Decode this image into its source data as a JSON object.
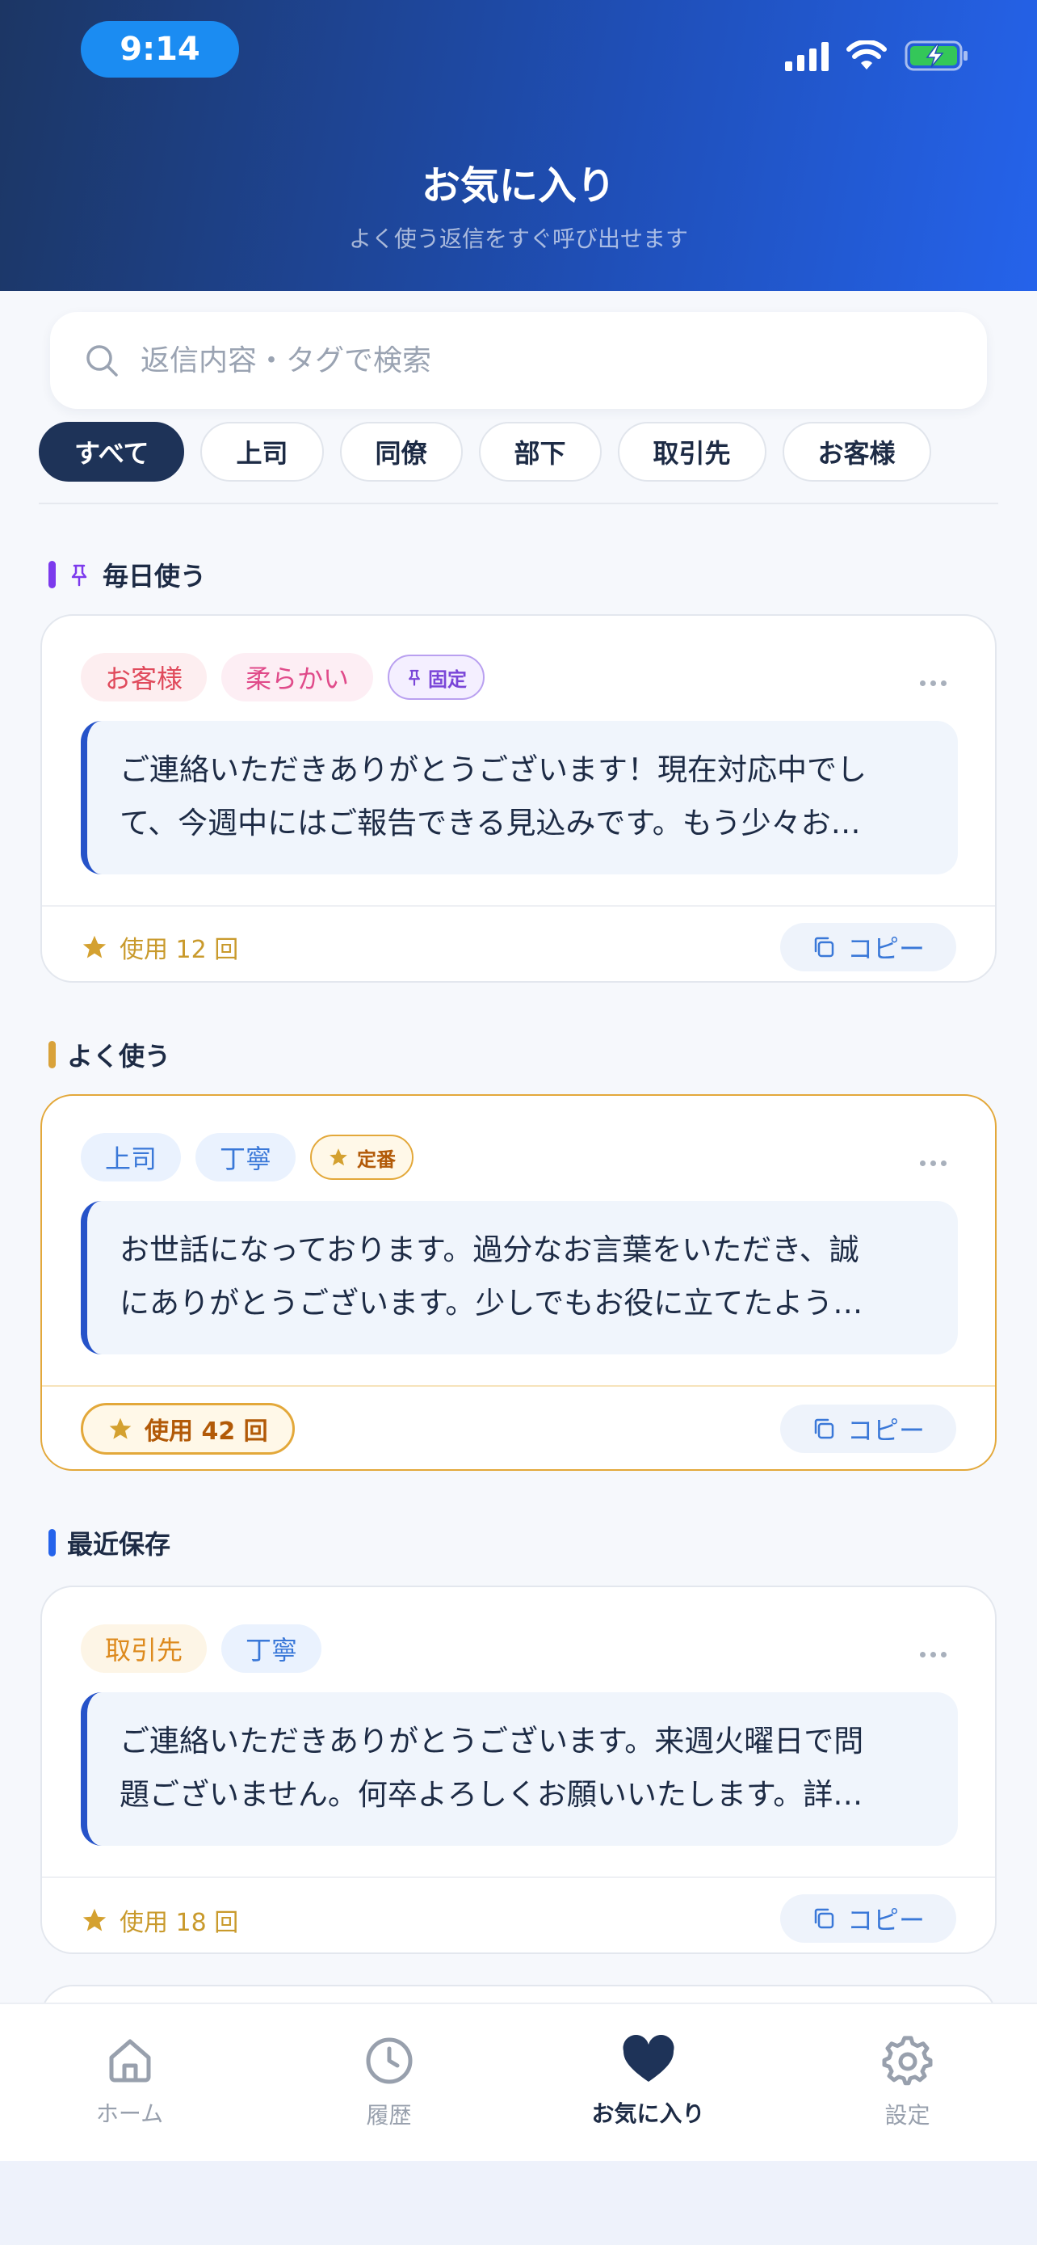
{
  "status_bar": {
    "time": "9:14"
  },
  "header": {
    "title": "お気に入り",
    "subtitle": "よく使う返信をすぐ呼び出せます"
  },
  "search": {
    "placeholder": "返信内容・タグで検索",
    "value": ""
  },
  "filters": [
    "すべて",
    "上司",
    "同僚",
    "部下",
    "取引先",
    "お客様"
  ],
  "active_filter": "すべて",
  "sections": [
    {
      "label": "毎日使う",
      "accent": "#7c3aed",
      "card": {
        "tags": [
          "お客様",
          "柔らかい"
        ],
        "badge": "固定",
        "text_line1": "ご連絡いただきありがとうございます！現在対応中でし",
        "text_line2": "て、今週中にはご報告できる見込みです。もう少々お…",
        "usage": "使用 12 回",
        "copy": "コピー"
      }
    },
    {
      "label": "よく使う",
      "accent": "#d9a23a",
      "card": {
        "tags": [
          "上司",
          "丁寧"
        ],
        "badge": "定番",
        "text_line1": "お世話になっております。過分なお言葉をいただき、誠",
        "text_line2": "にありがとうございます。少しでもお役に立てたよう…",
        "usage": "使用 42 回",
        "copy": "コピー"
      }
    },
    {
      "label": "最近保存",
      "accent": "#2563eb",
      "card": {
        "tags": [
          "取引先",
          "丁寧"
        ],
        "text_line1": "ご連絡いただきありがとうございます。来週火曜日で問",
        "text_line2": "題ございません。何卒よろしくお願いいたします。詳…",
        "usage": "使用 18 回",
        "copy": "コピー"
      }
    }
  ],
  "nav": [
    "ホーム",
    "履歴",
    "お気に入り",
    "設定"
  ],
  "active_nav": "お気に入り"
}
